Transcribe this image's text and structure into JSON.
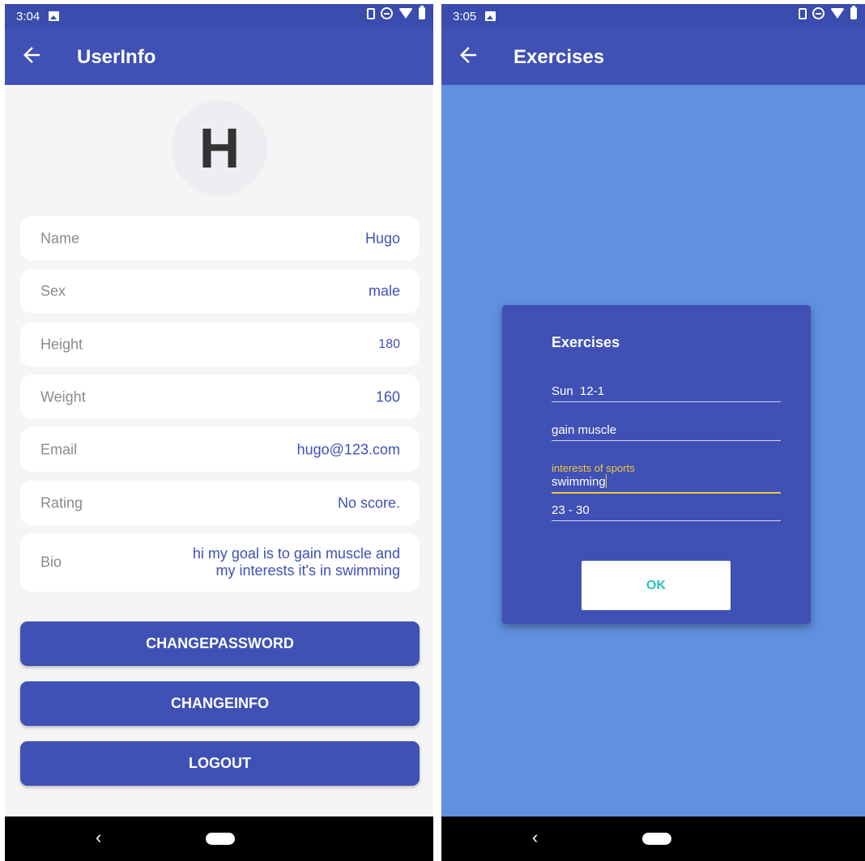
{
  "left_screen": {
    "status": {
      "time": "3:04"
    },
    "appbar": {
      "title": "UserInfo"
    },
    "avatar": {
      "initial": "H"
    },
    "fields": [
      {
        "label": "Name",
        "value": "Hugo"
      },
      {
        "label": "Sex",
        "value": "male"
      },
      {
        "label": "Height",
        "value": "180"
      },
      {
        "label": "Weight",
        "value": "160"
      },
      {
        "label": "Email",
        "value": "hugo@123.com"
      },
      {
        "label": "Rating",
        "value": "No score."
      },
      {
        "label": "Bio",
        "value": "hi my goal is to gain muscle and my interests it's in swimming"
      }
    ],
    "buttons": {
      "change_password": "CHANGEPASSWORD",
      "change_info": "CHANGEINFO",
      "logout": "LOGOUT"
    }
  },
  "right_screen": {
    "status": {
      "time": "3:05"
    },
    "appbar": {
      "title": "Exercises"
    },
    "dialog": {
      "title": "Exercises",
      "schedule": "Sun  12-1",
      "goal": "gain muscle",
      "interests_hint": "interests of sports",
      "interests_value": "swimming",
      "age_range": "23 - 30",
      "ok_label": "OK"
    }
  },
  "nav": {
    "back_glyph": "‹"
  },
  "colors": {
    "primary": "#3f51b5",
    "status_bar": "#3a4cad",
    "page_background_left": "#f5f5f5",
    "page_background_right": "#6190df",
    "accent_teal": "#26c6b3",
    "hint_yellow": "#f5c542",
    "label_gray": "#8a8a8a"
  },
  "icons": [
    "back-arrow-icon",
    "gallery-icon",
    "vibrate-icon",
    "do-not-disturb-icon",
    "wifi-icon",
    "battery-icon",
    "nav-back-icon",
    "nav-home-icon"
  ]
}
